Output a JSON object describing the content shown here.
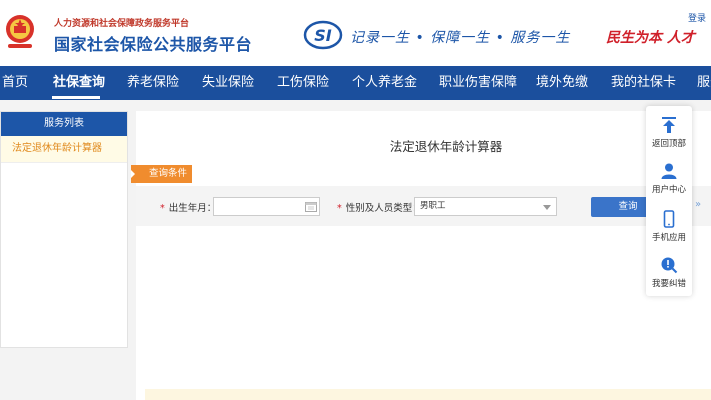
{
  "header": {
    "sub_title": "人力资源和社会保障政务服务平台",
    "main_title": "国家社会保险公共服务平台",
    "logo_text": "SI",
    "slogan": "记录一生 • 保障一生 • 服务一生",
    "slogan_right": "民生为本 人才",
    "login_label": "登录"
  },
  "nav": {
    "items": [
      "首页",
      "社保查询",
      "养老保险",
      "失业保险",
      "工伤保险",
      "个人养老金",
      "职业伤害保障",
      "境外免缴",
      "我的社保卡",
      "服务"
    ],
    "active_index": 1
  },
  "sidebar": {
    "header": "服务列表",
    "items": [
      "法定退休年龄计算器"
    ]
  },
  "content": {
    "title": "法定退休年龄计算器",
    "query_tag": "查询条件",
    "birth_label": "出生年月：",
    "birth_value": "",
    "type_label": "性别及人员类型：",
    "type_value": "男职工",
    "query_button": "查询"
  },
  "floating": {
    "items": [
      {
        "label": "返回顶部",
        "icon": "back-to-top-icon"
      },
      {
        "label": "用户中心",
        "icon": "user-icon"
      },
      {
        "label": "手机应用",
        "icon": "phone-icon"
      },
      {
        "label": "我要纠错",
        "icon": "error-report-icon"
      }
    ]
  },
  "colors": {
    "brand_blue": "#1b4f9d",
    "accent_orange": "#f08c2e",
    "required_red": "#d0202a"
  }
}
